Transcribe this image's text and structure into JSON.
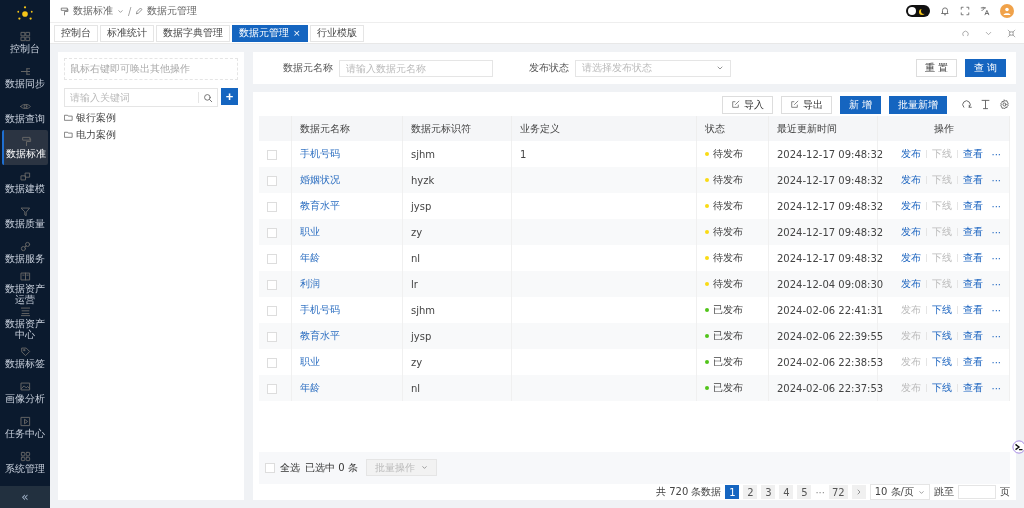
{
  "sidebar": {
    "items": [
      {
        "label": "控制台",
        "selected": false
      },
      {
        "label": "数据同步",
        "selected": false
      },
      {
        "label": "数据查询",
        "selected": false
      },
      {
        "label": "数据标准",
        "selected": true
      },
      {
        "label": "数据建模",
        "selected": false
      },
      {
        "label": "数据质量",
        "selected": false
      },
      {
        "label": "数据服务",
        "selected": false
      },
      {
        "label": "数据资产运营",
        "selected": false
      },
      {
        "label": "数据资产中心",
        "selected": false
      },
      {
        "label": "数据标签",
        "selected": false
      },
      {
        "label": "画像分析",
        "selected": false
      },
      {
        "label": "任务中心",
        "selected": false
      },
      {
        "label": "系统管理",
        "selected": false
      }
    ],
    "collapse": "«"
  },
  "breadcrumb": [
    "数据标准",
    "/",
    "数据元管理"
  ],
  "header": {
    "theme_toggle": {
      "on": false
    }
  },
  "tabs": [
    {
      "label": "控制台",
      "selected": false
    },
    {
      "label": "标准统计",
      "selected": false
    },
    {
      "label": "数据字典管理",
      "selected": false
    },
    {
      "label": "数据元管理",
      "selected": true,
      "close": "×"
    },
    {
      "label": "行业模版",
      "selected": false
    }
  ],
  "tree_panel": {
    "hint": "鼠标右键即可唤出其他操作",
    "search_placeholder": "请输入关键词",
    "add_button": "+",
    "items": [
      {
        "label": "银行案例"
      },
      {
        "label": "电力案例"
      }
    ]
  },
  "filter": {
    "fields": [
      {
        "kind": "input",
        "label": "数据元名称",
        "placeholder": "请输入数据元名称"
      },
      {
        "kind": "select",
        "label": "发布状态",
        "placeholder": "请选择发布状态"
      }
    ],
    "buttons": [
      {
        "label": "重 置",
        "kind": "default"
      },
      {
        "label": "查 询",
        "kind": "primary"
      }
    ]
  },
  "toolbar": {
    "buttons": [
      {
        "label": "导入",
        "kind": "icon"
      },
      {
        "label": "导出",
        "kind": "icon"
      },
      {
        "label": "新 增",
        "kind": "primary"
      },
      {
        "label": "批量新增",
        "kind": "primary"
      }
    ]
  },
  "table": {
    "columns": [
      "数据元名称",
      "数据元标识符",
      "业务定义",
      "状态",
      "最近更新时间",
      "操作"
    ],
    "rows": [
      {
        "checked": false,
        "name": "手机号码",
        "identifier": "sjhm",
        "definition": "1",
        "status": {
          "kind": "pending",
          "label": "待发布"
        },
        "time": "2024-12-17 09:48:32",
        "actions": [
          {
            "label": "发布",
            "disabled": false
          },
          {
            "label": "下线",
            "disabled": true
          },
          {
            "label": "查看",
            "disabled": false
          }
        ],
        "more": "···"
      },
      {
        "checked": false,
        "name": "婚姻状况",
        "identifier": "hyzk",
        "definition": "",
        "status": {
          "kind": "pending",
          "label": "待发布"
        },
        "time": "2024-12-17 09:48:32",
        "actions": [
          {
            "label": "发布",
            "disabled": false
          },
          {
            "label": "下线",
            "disabled": true
          },
          {
            "label": "查看",
            "disabled": false
          }
        ],
        "more": "···"
      },
      {
        "checked": false,
        "name": "教育水平",
        "identifier": "jysp",
        "definition": "",
        "status": {
          "kind": "pending",
          "label": "待发布"
        },
        "time": "2024-12-17 09:48:32",
        "actions": [
          {
            "label": "发布",
            "disabled": false
          },
          {
            "label": "下线",
            "disabled": true
          },
          {
            "label": "查看",
            "disabled": false
          }
        ],
        "more": "···"
      },
      {
        "checked": false,
        "name": "职业",
        "identifier": "zy",
        "definition": "",
        "status": {
          "kind": "pending",
          "label": "待发布"
        },
        "time": "2024-12-17 09:48:32",
        "actions": [
          {
            "label": "发布",
            "disabled": false
          },
          {
            "label": "下线",
            "disabled": true
          },
          {
            "label": "查看",
            "disabled": false
          }
        ],
        "more": "···"
      },
      {
        "checked": false,
        "name": "年龄",
        "identifier": "nl",
        "definition": "",
        "status": {
          "kind": "pending",
          "label": "待发布"
        },
        "time": "2024-12-17 09:48:32",
        "actions": [
          {
            "label": "发布",
            "disabled": false
          },
          {
            "label": "下线",
            "disabled": true
          },
          {
            "label": "查看",
            "disabled": false
          }
        ],
        "more": "···"
      },
      {
        "checked": false,
        "name": "利润",
        "identifier": "lr",
        "definition": "",
        "status": {
          "kind": "pending",
          "label": "待发布"
        },
        "time": "2024-12-04 09:08:30",
        "actions": [
          {
            "label": "发布",
            "disabled": false
          },
          {
            "label": "下线",
            "disabled": true
          },
          {
            "label": "查看",
            "disabled": false
          }
        ],
        "more": "···"
      },
      {
        "checked": false,
        "name": "手机号码",
        "identifier": "sjhm",
        "definition": "",
        "status": {
          "kind": "published",
          "label": "已发布"
        },
        "time": "2024-02-06 22:41:31",
        "actions": [
          {
            "label": "发布",
            "disabled": true
          },
          {
            "label": "下线",
            "disabled": false
          },
          {
            "label": "查看",
            "disabled": false
          }
        ],
        "more": "···"
      },
      {
        "checked": false,
        "name": "教育水平",
        "identifier": "jysp",
        "definition": "",
        "status": {
          "kind": "published",
          "label": "已发布"
        },
        "time": "2024-02-06 22:39:55",
        "actions": [
          {
            "label": "发布",
            "disabled": true
          },
          {
            "label": "下线",
            "disabled": false
          },
          {
            "label": "查看",
            "disabled": false
          }
        ],
        "more": "···"
      },
      {
        "checked": false,
        "name": "职业",
        "identifier": "zy",
        "definition": "",
        "status": {
          "kind": "published",
          "label": "已发布"
        },
        "time": "2024-02-06 22:38:53",
        "actions": [
          {
            "label": "发布",
            "disabled": true
          },
          {
            "label": "下线",
            "disabled": false
          },
          {
            "label": "查看",
            "disabled": false
          }
        ],
        "more": "···"
      },
      {
        "checked": false,
        "name": "年龄",
        "identifier": "nl",
        "definition": "",
        "status": {
          "kind": "published",
          "label": "已发布"
        },
        "time": "2024-02-06 22:37:53",
        "actions": [
          {
            "label": "发布",
            "disabled": true
          },
          {
            "label": "下线",
            "disabled": false
          },
          {
            "label": "查看",
            "disabled": false
          }
        ],
        "more": "···"
      }
    ]
  },
  "footer": {
    "select_all": {
      "label": "全选",
      "checked": false
    },
    "selected_count": "已选中 0 条",
    "batch": {
      "label": "批量操作",
      "disabled": true
    }
  },
  "pagination": {
    "total": "共 720 条数据",
    "pages": [
      {
        "kind": "page",
        "label": "1",
        "selected": true
      },
      {
        "kind": "page",
        "label": "2",
        "selected": false
      },
      {
        "kind": "page",
        "label": "3",
        "selected": false
      },
      {
        "kind": "page",
        "label": "4",
        "selected": false
      },
      {
        "kind": "page",
        "label": "5",
        "selected": false
      },
      {
        "kind": "ellipsis",
        "label": "···"
      },
      {
        "kind": "page",
        "label": "72",
        "selected": false
      }
    ],
    "page_size": "10 条/页",
    "jump_label": "跳至",
    "page_suffix": "页"
  }
}
